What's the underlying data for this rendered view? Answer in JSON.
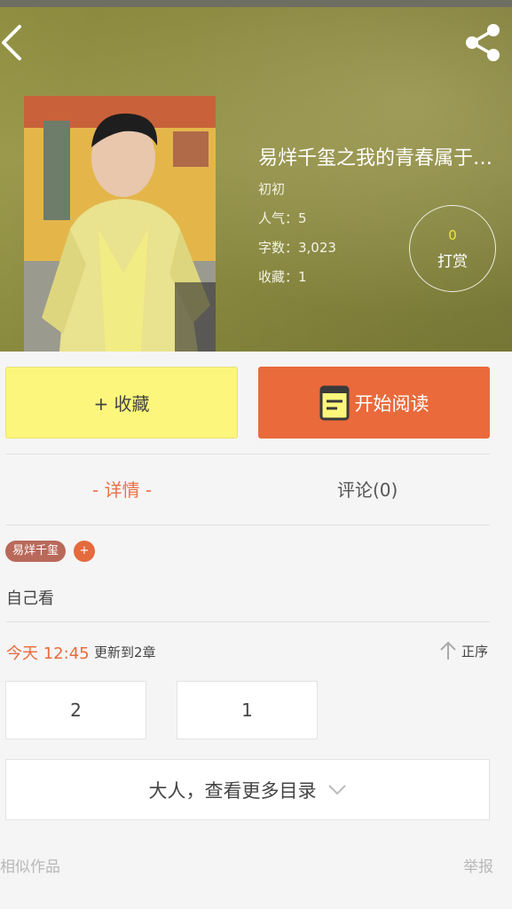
{
  "book": {
    "title": "易烊千玺之我的青春属于…",
    "author": "初初",
    "popularity_label": "人气：5",
    "word_count_label": "字数：3,023",
    "favorites_label": "收藏：1"
  },
  "tip": {
    "count": "0",
    "label": "打赏"
  },
  "actions": {
    "collect_label": "+ 收藏",
    "read_label": "开始阅读"
  },
  "tabs": {
    "detail_label": "- 详情 -",
    "comments_label": "评论(0)"
  },
  "tags": {
    "items": [
      "易烊千玺"
    ],
    "add_label": "+"
  },
  "description": "自己看",
  "update": {
    "time": "今天 12:45",
    "text": "更新到2章",
    "sort_label": "正序"
  },
  "chapters": [
    "2",
    "1"
  ],
  "more_label": "大人，查看更多目录",
  "footer": {
    "similar_label": "相似作品",
    "report_label": "举报"
  },
  "colors": {
    "accent_orange": "#ea6a3c",
    "collect_yellow": "#fdf67c",
    "tag_brown": "#b9695a",
    "tip_count_yellow": "#f3e34a"
  }
}
